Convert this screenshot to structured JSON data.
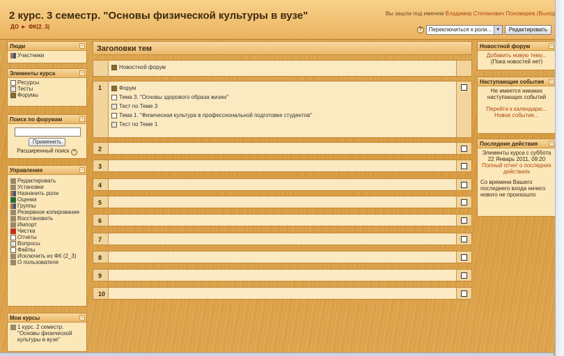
{
  "header": {
    "course_title": "2 курс. 3 семестр. \"Основы физической культуры в вузе\"",
    "login_prefix": "Вы зашли под именем",
    "login_user": "Владимир Степанович Пономарев",
    "logout": "(Выход)"
  },
  "navbar": {
    "crumb_home": "ДО",
    "crumb_sep": "►",
    "crumb_course": "ФК(2_3)",
    "role_select": "Переключиться к роли...",
    "edit_button": "Редактировать"
  },
  "left": {
    "people": {
      "title": "Люди",
      "items": [
        "Участники"
      ]
    },
    "elements": {
      "title": "Элементы курса",
      "items": [
        "Ресурсы",
        "Тесты",
        "Форумы"
      ]
    },
    "search": {
      "title": "Поиск по форумам",
      "apply": "Применить",
      "advanced": "Расширенный поиск"
    },
    "admin": {
      "title": "Управление",
      "items": [
        "Редактировать",
        "Установки",
        "Назначить роли",
        "Оценки",
        "Группы",
        "Резервное копирование",
        "Восстановить",
        "Импорт",
        "Чистка",
        "Отчеты",
        "Вопросы",
        "Файлы",
        "Исключить из ФК (2_3)",
        "О пользователе"
      ]
    },
    "mycourses": {
      "title": "Мои курсы",
      "items": [
        "1 курс. 2 семестр. \"Основы физической культуры в вузе\""
      ]
    }
  },
  "main": {
    "title": "Заголовки тем",
    "section0": [
      "Новостной форум"
    ],
    "section1": [
      {
        "icon": "forum-icon",
        "text": "Форум"
      },
      {
        "icon": "resource-icon",
        "text": "Тема 3. \"Основы здорового образа жизни\""
      },
      {
        "icon": "quiz-icon",
        "text": "Тест по Теме 3"
      },
      {
        "icon": "resource-icon",
        "text": "Тема 1. \"Физическая культура в профессиональной подготовке студентов\""
      },
      {
        "icon": "quiz-icon",
        "text": "Тест по Теме 1"
      }
    ],
    "numbers": [
      "1",
      "2",
      "3",
      "4",
      "5",
      "6",
      "7",
      "8",
      "9",
      "10"
    ]
  },
  "right": {
    "news": {
      "title": "Новостной форум",
      "add": "Добавить новую тему...",
      "none": "(Пока новостей нет)"
    },
    "events": {
      "title": "Наступающие события",
      "none": "Не имеется никаких наступающих событий",
      "calendar": "Перейти к календарю...",
      "new_event": "Новое событие..."
    },
    "recent": {
      "title": "Последние действия",
      "since": "Элементы курса с суббота 22 Январь 2011, 09:20",
      "full_report": "Полный отчет о последних действиях",
      "nothing": "Со времени Вашего последнего входа ничего нового не произошло"
    }
  }
}
